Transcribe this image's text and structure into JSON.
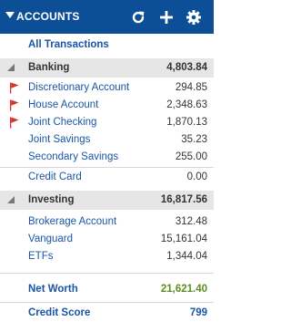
{
  "header": {
    "title": "ACCOUNTS"
  },
  "all_transactions": "All Transactions",
  "banking": {
    "label": "Banking",
    "total": "4,803.84",
    "accounts": [
      {
        "name": "Discretionary Account",
        "balance": "294.85",
        "flagged": true
      },
      {
        "name": "House Account",
        "balance": "2,348.63",
        "flagged": true
      },
      {
        "name": "Joint Checking",
        "balance": "1,870.13",
        "flagged": true
      },
      {
        "name": "Joint Savings",
        "balance": "35.23",
        "flagged": false
      },
      {
        "name": "Secondary Savings",
        "balance": "255.00",
        "flagged": false
      },
      {
        "name": "Credit Card",
        "balance": "0.00",
        "flagged": false
      }
    ]
  },
  "investing": {
    "label": "Investing",
    "total": "16,817.56",
    "accounts": [
      {
        "name": "Brokerage Account",
        "balance": "312.48"
      },
      {
        "name": "Vanguard",
        "balance": "15,161.04"
      },
      {
        "name": "ETFs",
        "balance": "1,344.04"
      }
    ]
  },
  "net_worth": {
    "label": "Net Worth",
    "value": "21,621.40",
    "color": "#5a8f1e"
  },
  "credit_score": {
    "label": "Credit Score",
    "value": "799"
  },
  "colors": {
    "header_bg": "#0d4f97",
    "link": "#1a55a6",
    "flag": "#d7322b",
    "group_bg": "#e6e6e6"
  },
  "icons": [
    "collapse-caret-icon",
    "refresh-icon",
    "add-icon",
    "gear-icon",
    "flag-icon",
    "expand-triangle-icon"
  ]
}
